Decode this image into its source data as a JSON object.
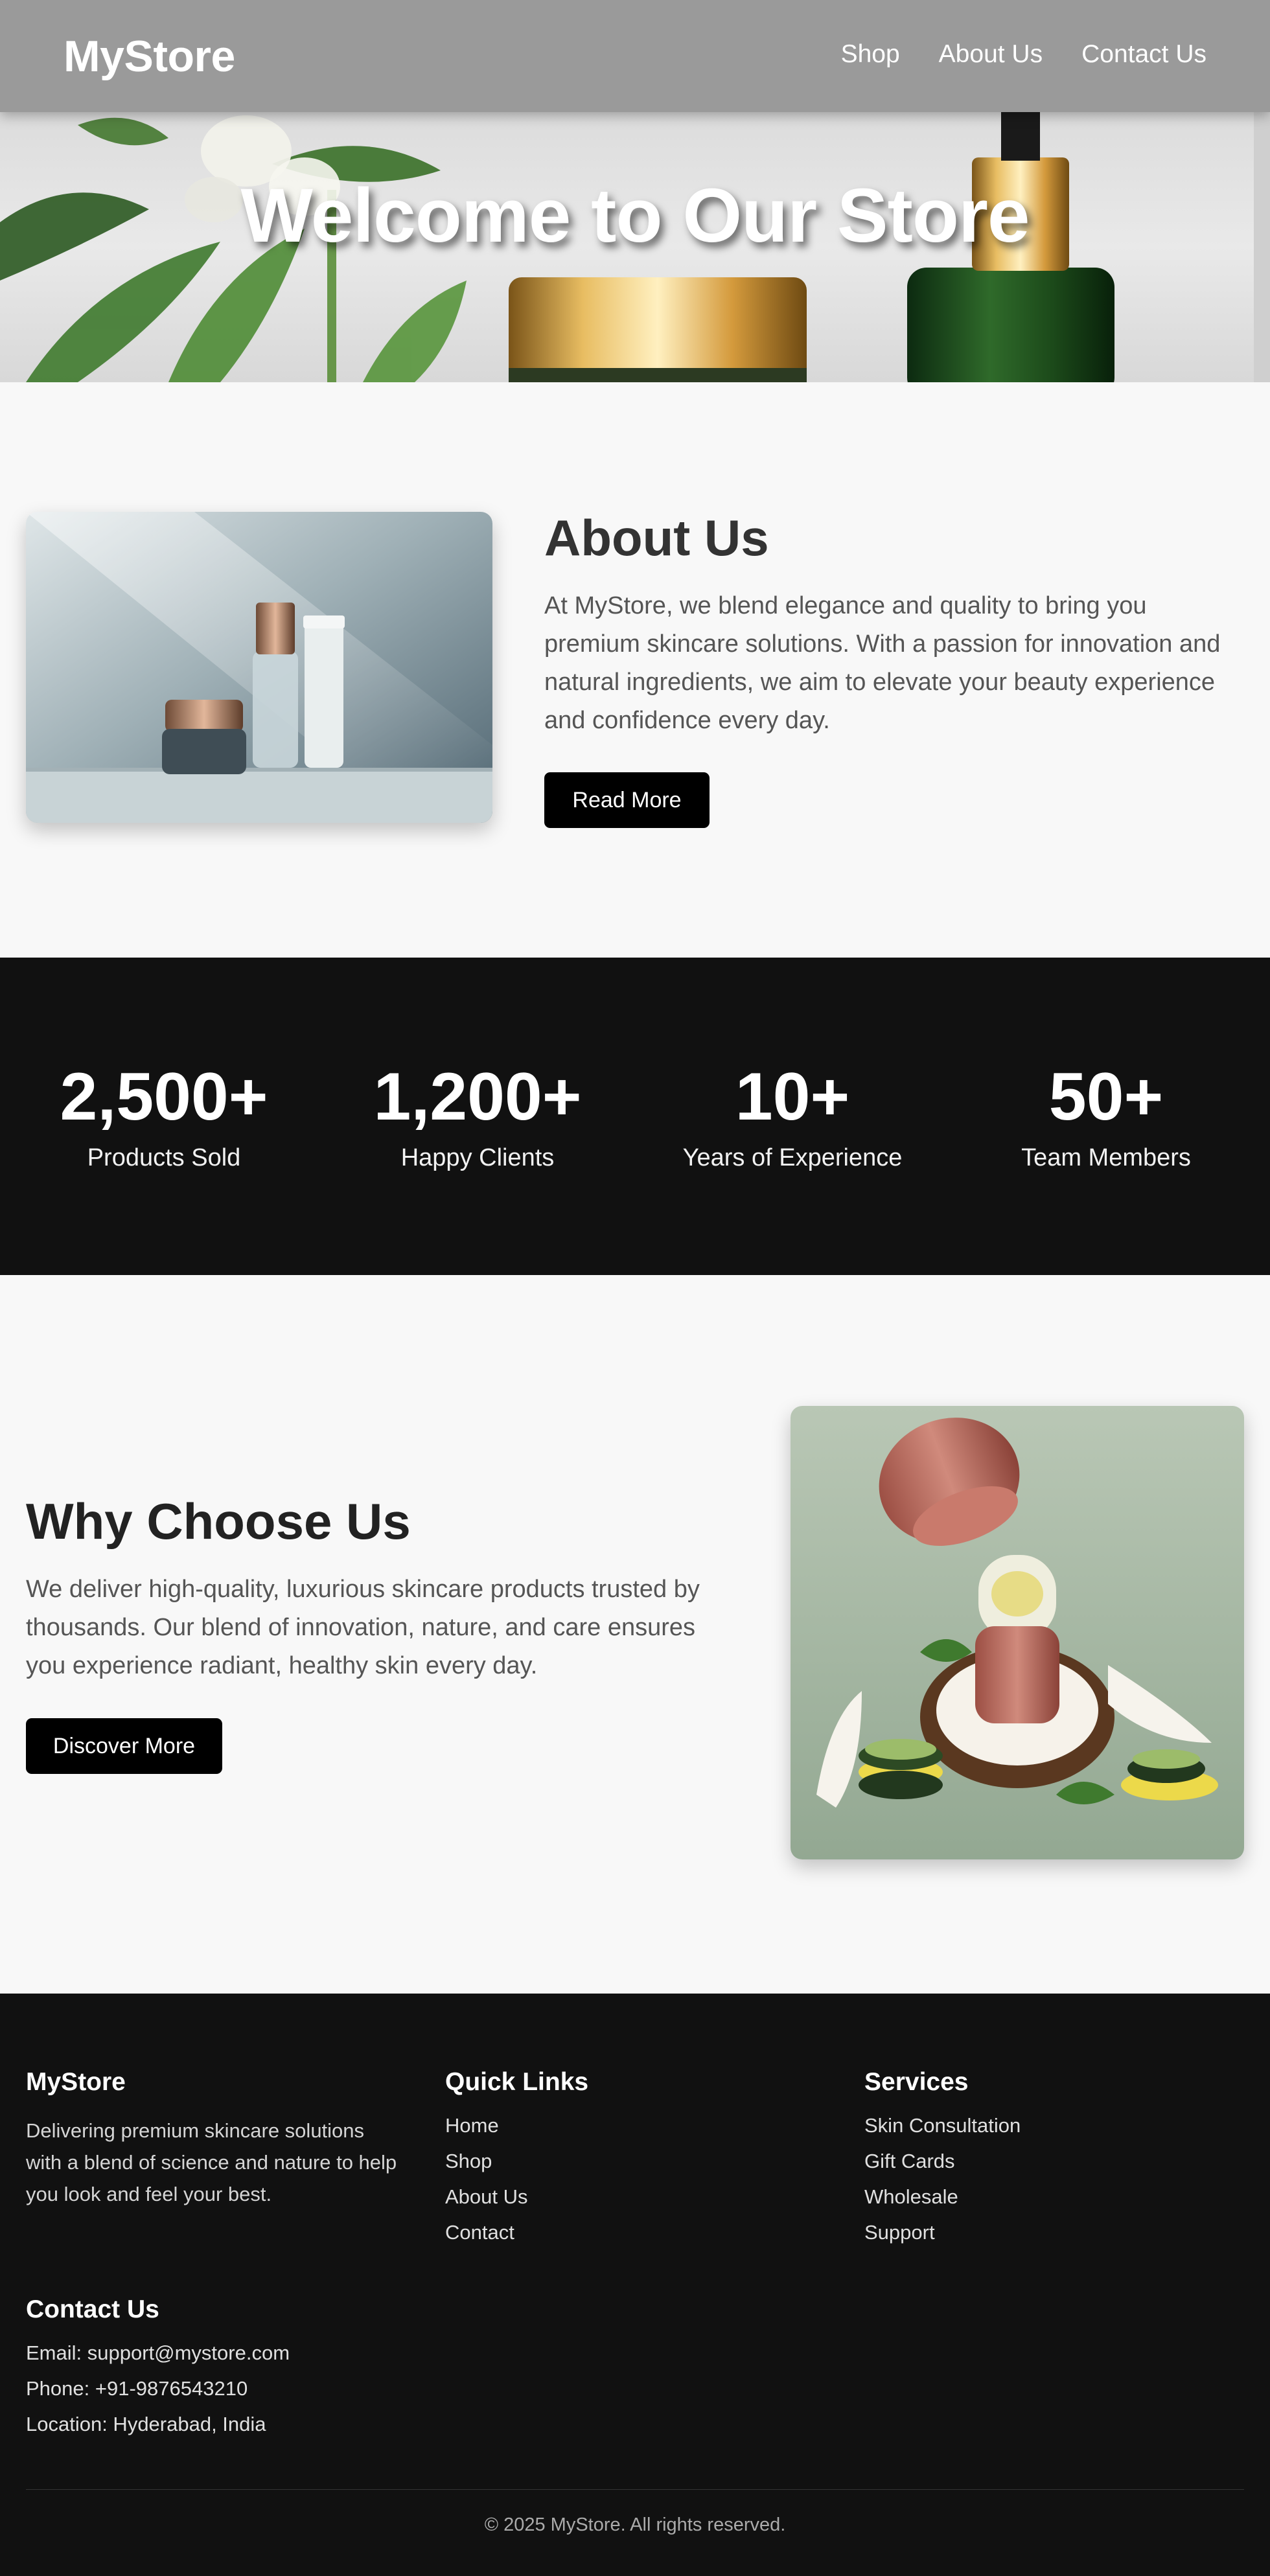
{
  "header": {
    "logo": "MyStore",
    "nav": [
      "Shop",
      "About Us",
      "Contact Us"
    ]
  },
  "hero": {
    "title": "Welcome to Our Store"
  },
  "about": {
    "title": "About Us",
    "text": "At MyStore, we blend elegance and quality to bring you premium skincare solutions. With a passion for innovation and natural ingredients, we aim to elevate your beauty experience and confidence every day.",
    "button": "Read More"
  },
  "stats": [
    {
      "value": "2,500+",
      "label": "Products Sold"
    },
    {
      "value": "1,200+",
      "label": "Happy Clients"
    },
    {
      "value": "10+",
      "label": "Years of Experience"
    },
    {
      "value": "50+",
      "label": "Team Members"
    }
  ],
  "why": {
    "title": "Why Choose Us",
    "text": "We deliver high-quality, luxurious skincare products trusted by thousands. Our blend of innovation, nature, and care ensures you experience radiant, healthy skin every day.",
    "button": "Discover More"
  },
  "footer": {
    "brand": {
      "title": "MyStore",
      "text": "Delivering premium skincare solutions with a blend of science and nature to help you look and feel your best."
    },
    "quick_links": {
      "title": "Quick Links",
      "items": [
        "Home",
        "Shop",
        "About Us",
        "Contact"
      ]
    },
    "services": {
      "title": "Services",
      "items": [
        "Skin Consultation",
        "Gift Cards",
        "Wholesale",
        "Support"
      ]
    },
    "contact": {
      "title": "Contact Us",
      "email": "Email: support@mystore.com",
      "phone": "Phone: +91-9876543210",
      "location": "Location: Hyderabad, India"
    },
    "copyright": "© 2025 MyStore. All rights reserved."
  },
  "colors": {
    "header_bg": "#9a9a9a",
    "dark_bg": "#111111",
    "page_bg": "#f8f8f8",
    "button_bg": "#000000"
  }
}
